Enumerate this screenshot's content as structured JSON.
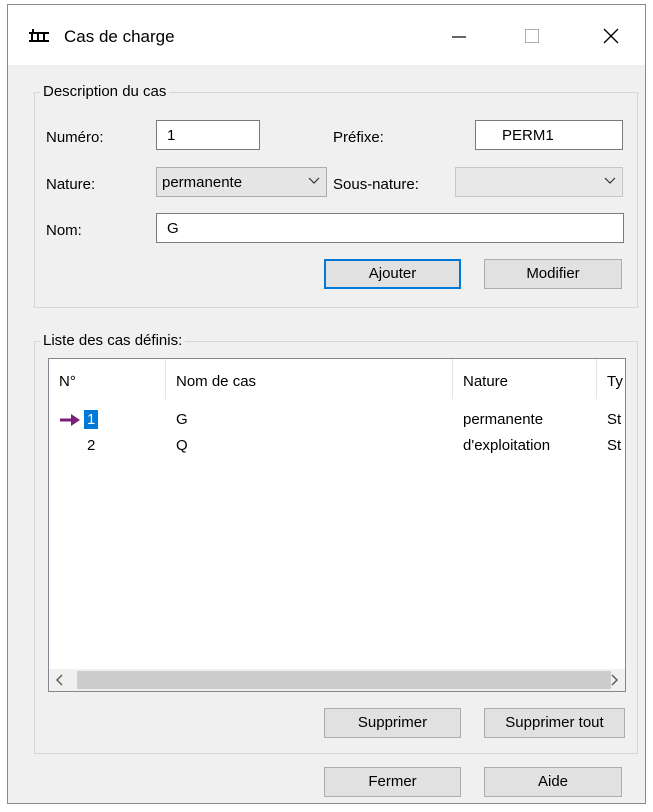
{
  "window": {
    "title": "Cas de charge",
    "icon": "load-case-icon"
  },
  "description": {
    "legend": "Description du cas",
    "numero_label": "Numéro:",
    "numero_value": "1",
    "prefixe_label": "Préfixe:",
    "prefixe_value": "PERM1",
    "nature_label": "Nature:",
    "nature_value": "permanente",
    "sousnature_label": "Sous-nature:",
    "sousnature_value": "",
    "nom_label": "Nom:",
    "nom_value": "G",
    "ajouter": "Ajouter",
    "modifier": "Modifier"
  },
  "list": {
    "legend": "Liste des cas définis:",
    "columns": [
      "N°",
      "Nom de cas",
      "Nature",
      "Ty"
    ],
    "rows": [
      {
        "no": "1",
        "nom": "G",
        "nature": "permanente",
        "type": "St",
        "selected": true
      },
      {
        "no": "2",
        "nom": "Q",
        "nature": "d'exploitation",
        "type": "St",
        "selected": false
      }
    ],
    "supprimer": "Supprimer",
    "supprimer_tout": "Supprimer tout"
  },
  "footer": {
    "fermer": "Fermer",
    "aide": "Aide"
  },
  "colors": {
    "accent": "#0078d7",
    "arrow": "#7a1f7a"
  }
}
